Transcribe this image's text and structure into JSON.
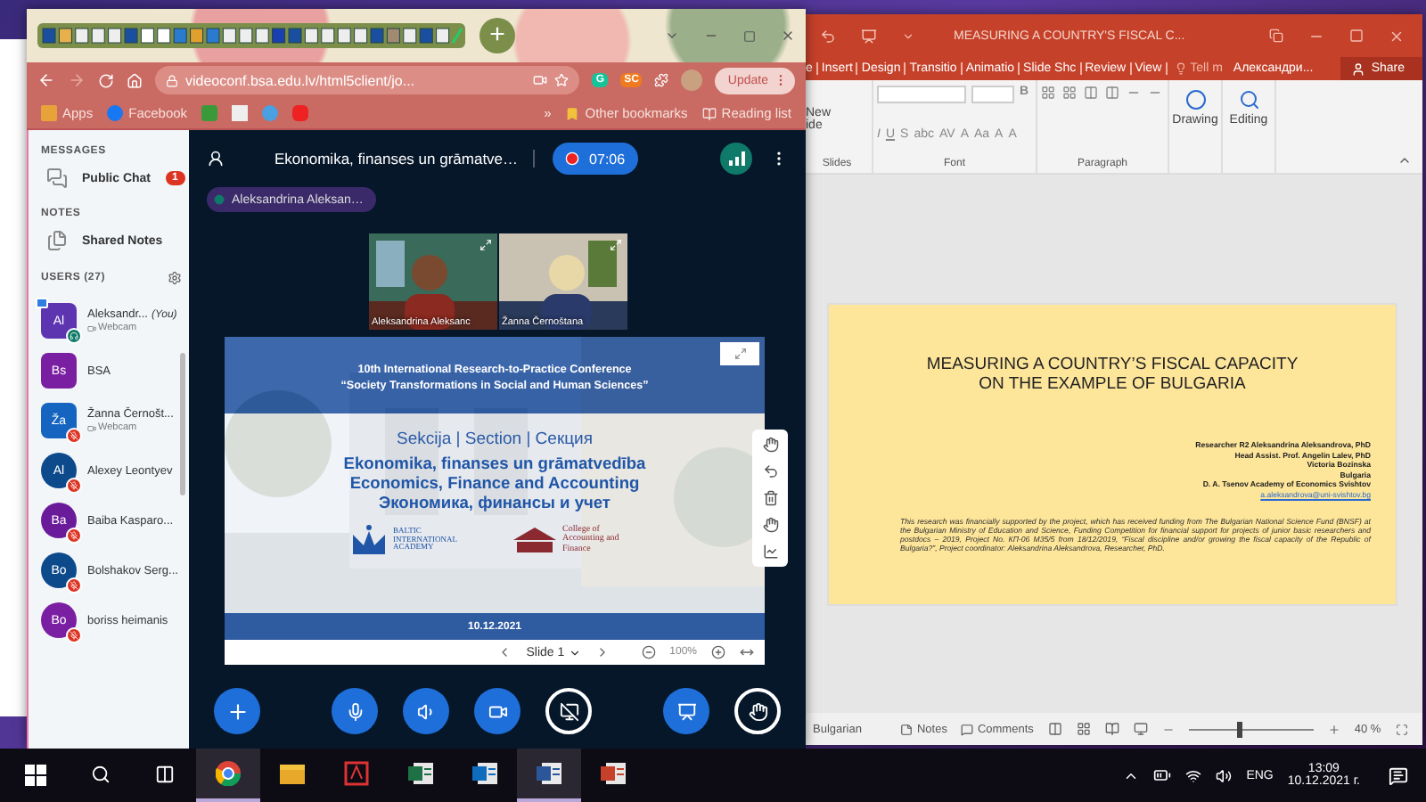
{
  "browser": {
    "new_tab": "+",
    "url": "videoconf.bsa.edu.lv/html5client/jo...",
    "extensions": [
      "G",
      "SC"
    ],
    "update_button": "Update",
    "bookmarks": [
      {
        "kind": "apps",
        "label": "Apps"
      },
      {
        "kind": "facebook",
        "label": "Facebook"
      },
      {
        "kind": "home"
      },
      {
        "kind": "qr"
      },
      {
        "kind": "globe"
      },
      {
        "kind": "youtube"
      }
    ],
    "bookmarks_more": "»",
    "other_bookmarks": "Other bookmarks",
    "reading_list": "Reading list"
  },
  "sidebar": {
    "messages_heading": "MESSAGES",
    "public_chat": {
      "label": "Public Chat",
      "badge": "1"
    },
    "notes_heading": "NOTES",
    "shared_notes": "Shared Notes",
    "users_heading": "USERS (27)",
    "users": [
      {
        "initials": "Al",
        "name": "Aleksandr...",
        "you": "(You)",
        "status": "Webcam",
        "kind": "moderator",
        "presenter": true,
        "listen_only": true,
        "muted": false,
        "color": "#5e35b1"
      },
      {
        "initials": "Bs",
        "name": "BSA",
        "kind": "moderator",
        "presenter": false,
        "listen_only": false,
        "muted": false,
        "color": "#7b1fa2"
      },
      {
        "initials": "Ža",
        "name": "Žanna Černošt...",
        "status": "Webcam",
        "kind": "moderator",
        "presenter": false,
        "listen_only": false,
        "muted": true,
        "color": "#1565c0"
      },
      {
        "initials": "Al",
        "name": "Alexey Leontyev",
        "kind": "viewer",
        "presenter": false,
        "listen_only": false,
        "muted": true,
        "color": "#0d4a8c"
      },
      {
        "initials": "Ba",
        "name": "Baiba Kasparo...",
        "kind": "viewer",
        "presenter": false,
        "listen_only": false,
        "muted": true,
        "color": "#6a1b9a"
      },
      {
        "initials": "Bo",
        "name": "Bolshakov Serg...",
        "kind": "viewer",
        "presenter": false,
        "listen_only": false,
        "muted": true,
        "color": "#0d4a8c"
      },
      {
        "initials": "Bo",
        "name": "boriss heimanis",
        "kind": "viewer",
        "presenter": false,
        "listen_only": false,
        "muted": true,
        "color": "#7b1fa2"
      }
    ]
  },
  "meeting": {
    "title": "Ekonomika, finanses un grāmatve…",
    "recording_time": "07:06",
    "presenter": "Aleksandrina Aleksan…",
    "webcams": [
      {
        "name": "Aleksandrina Aleksanc"
      },
      {
        "name": "Žanna Černoštana"
      }
    ],
    "slide": {
      "header": [
        "10th International Research-to-Practice Conference",
        "“Society Transformations in Social and Human Sciences”"
      ],
      "section": "Sekcija | Section | Секция",
      "titles": [
        "Ekonomika, finanses un grāmatvedība",
        "Economics, Finance and Accounting",
        "Экономика, финансы и учет"
      ],
      "academy": "BALTIC INTERNATIONAL ACADEMY",
      "college": "College of Accounting and Finance",
      "date": "10.12.2021"
    },
    "slide_label": "Slide 1",
    "zoom": "100%"
  },
  "powerpoint": {
    "title": "MEASURING A COUNTRY'S FISCAL C...",
    "tabs": [
      "e",
      "Insert",
      "Design",
      "Transitio",
      "Animatio",
      "Slide Shc",
      "Review",
      "View"
    ],
    "tell_me": "Tell m",
    "user": "Александри...",
    "share": "Share",
    "new_slide": [
      "New",
      "ide"
    ],
    "font_buttons": [
      "B",
      "I",
      "U",
      "S",
      "abc",
      "AV"
    ],
    "font_size_buttons": [
      "A",
      "Aa",
      "A",
      "A"
    ],
    "groups": [
      "Slides",
      "Font",
      "Paragraph"
    ],
    "drawing": "Drawing",
    "editing": "Editing",
    "slide": {
      "title": [
        "MEASURING A COUNTRY’S FISCAL CAPACITY",
        "ON THE EXAMPLE OF BULGARIA"
      ],
      "authors": [
        "Researcher R2 Aleksandrina Aleksandrova, PhD",
        "Head Assist. Prof. Angelin Lalev, PhD",
        "Victoria Bozinska",
        "Bulgaria",
        "D. A. Tsenov Academy of Economics Svishtov"
      ],
      "email": "a.aleksandrova@uni-svishtov.bg",
      "funding": "This research was financially supported by the project, which has received funding from The Bulgarian National Science Fund (BNSF) at the Bulgarian Ministry of Education and Science, Funding Competition for financial support for projects of junior basic researchers and postdocs – 2019, Project No. КП-06 М35/5 from 18/12/2019, “Fiscal discipline and/or growing the fiscal capacity of the Republic of Bulgaria?”, Project coordinator: Aleksandrina Aleksandrova, Researcher, PhD."
    },
    "status": {
      "language": "Bulgarian",
      "notes": "Notes",
      "comments": "Comments",
      "zoom": "40 %",
      "level": 0.4
    }
  },
  "taskbar": {
    "apps": [
      {
        "kind": "chrome",
        "active": true
      },
      {
        "kind": "explorer",
        "active": false
      },
      {
        "kind": "acrobat",
        "active": false
      },
      {
        "kind": "excel",
        "active": false
      },
      {
        "kind": "outlook",
        "active": false
      },
      {
        "kind": "word",
        "active": true
      },
      {
        "kind": "powerpoint",
        "active": false
      }
    ],
    "language": "ENG",
    "time": "13:09",
    "date": "10.12.2021 г."
  }
}
